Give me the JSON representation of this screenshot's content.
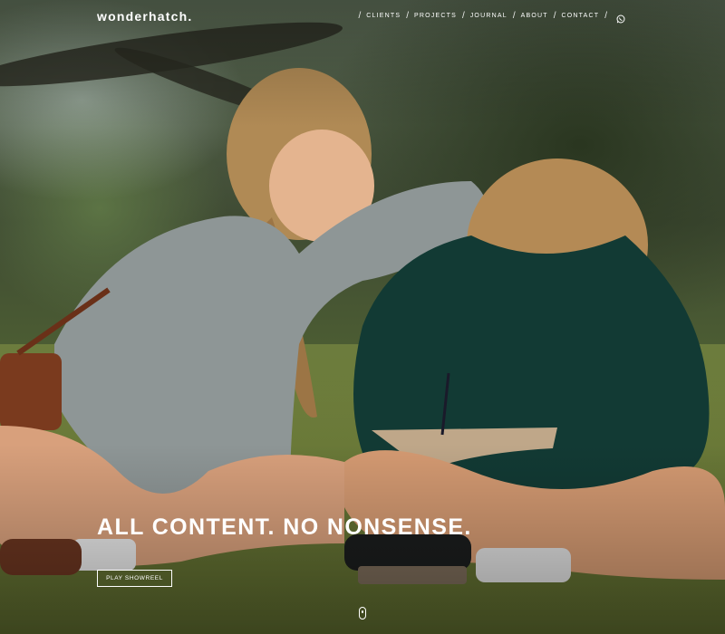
{
  "header": {
    "logo": "wonderhatch.",
    "nav": {
      "separator": "/",
      "items": [
        {
          "label": "CLIENTS"
        },
        {
          "label": "PROJECTS"
        },
        {
          "label": "JOURNAL"
        },
        {
          "label": "ABOUT"
        },
        {
          "label": "CONTACT"
        }
      ],
      "whatsapp_icon": "whatsapp-icon"
    }
  },
  "hero": {
    "headline": "ALL CONTENT. NO NONSENSE.",
    "cta_label": "PLAY SHOWREEL",
    "background_image": "photo of two children sitting on grass, one writing in a notebook",
    "scroll_icon": "mouse-scroll-icon"
  },
  "colors": {
    "text": "#ffffff",
    "accent_border": "#ffffff"
  }
}
